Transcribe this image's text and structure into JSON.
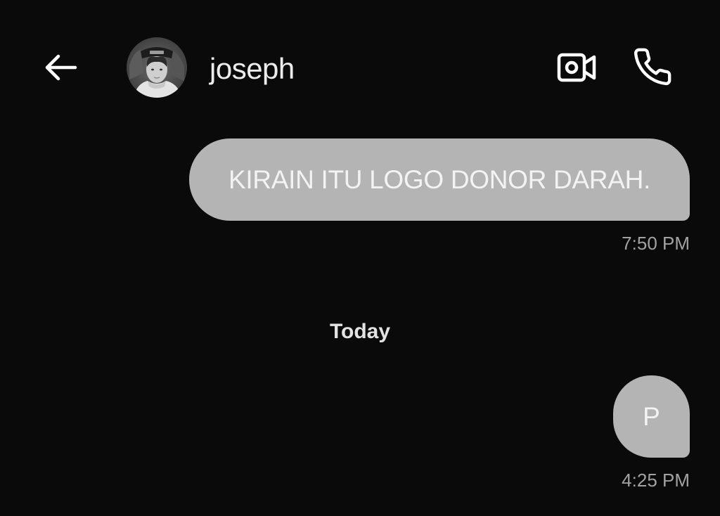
{
  "header": {
    "contact_name": "joseph",
    "back_icon": "arrow-left-icon",
    "video_icon": "video-camera-icon",
    "call_icon": "phone-icon"
  },
  "messages": [
    {
      "text": "KIRAIN ITU LOGO DONOR DARAH.",
      "time": "7:50 PM",
      "direction": "outgoing"
    },
    {
      "text": "P",
      "time": "4:25 PM",
      "direction": "outgoing"
    }
  ],
  "date_divider": "Today",
  "colors": {
    "background": "#0a0a0a",
    "bubble": "#b4b4b4",
    "bubble_text": "#f3f3f3",
    "timestamp": "#a2a2a2",
    "header_text": "#ececec"
  }
}
